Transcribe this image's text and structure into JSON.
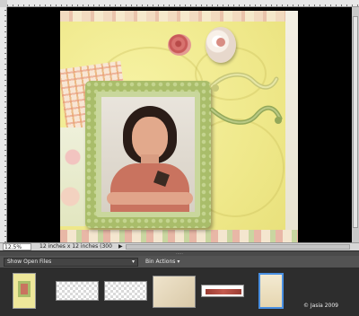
{
  "status_bar": {
    "zoom": "12.5%",
    "doc_info": "12 inches x 12 inches (300 ppi)",
    "arrow": "▶"
  },
  "bin_bar": {
    "show_open_files": "Show Open Files",
    "bin_actions": "Bin Actions",
    "chevron": "▾"
  },
  "copyright": "© Jasia 2009",
  "colors": {
    "page_yellow": "#efe88a",
    "frame_green": "#a9bd6a",
    "dress_red": "#c9735f",
    "selection_blue": "#4a90e2"
  },
  "icons": {
    "divider_grip": "·····"
  }
}
